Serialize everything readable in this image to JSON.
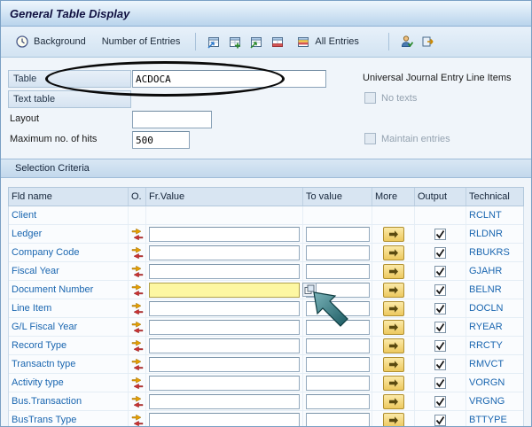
{
  "window": {
    "title": "General Table Display"
  },
  "toolbar": {
    "background": "Background",
    "number_of_entries": "Number of Entries",
    "all_entries": "All Entries"
  },
  "form": {
    "table_label": "Table",
    "table_value": "ACDOCA",
    "table_description": "Universal Journal Entry Line Items",
    "text_table_label": "Text table",
    "no_texts_label": "No texts",
    "layout_label": "Layout",
    "layout_value": "",
    "max_hits_label": "Maximum no. of hits",
    "max_hits_value": "500",
    "maintain_entries_label": "Maintain entries"
  },
  "selection": {
    "title": "Selection Criteria",
    "columns": [
      "Fld name",
      "O.",
      "Fr.Value",
      "To value",
      "More",
      "Output",
      "Technical"
    ],
    "rows": [
      {
        "name": "Client",
        "technical": "RCLNT",
        "option": false,
        "inputs": false,
        "more": false,
        "output": null,
        "highlight": false,
        "multi_icon": false
      },
      {
        "name": "Ledger",
        "technical": "RLDNR",
        "option": true,
        "inputs": true,
        "more": true,
        "output": true,
        "highlight": false,
        "multi_icon": false
      },
      {
        "name": "Company Code",
        "technical": "RBUKRS",
        "option": true,
        "inputs": true,
        "more": true,
        "output": true,
        "highlight": false,
        "multi_icon": false
      },
      {
        "name": "Fiscal Year",
        "technical": "GJAHR",
        "option": true,
        "inputs": true,
        "more": true,
        "output": true,
        "highlight": false,
        "multi_icon": false
      },
      {
        "name": "Document Number",
        "technical": "BELNR",
        "option": true,
        "inputs": true,
        "more": true,
        "output": true,
        "highlight": true,
        "multi_icon": true
      },
      {
        "name": "Line Item",
        "technical": "DOCLN",
        "option": true,
        "inputs": true,
        "more": true,
        "output": true,
        "highlight": false,
        "multi_icon": false
      },
      {
        "name": "G/L Fiscal Year",
        "technical": "RYEAR",
        "option": true,
        "inputs": true,
        "more": true,
        "output": true,
        "highlight": false,
        "multi_icon": false
      },
      {
        "name": "Record Type",
        "technical": "RRCTY",
        "option": true,
        "inputs": true,
        "more": true,
        "output": true,
        "highlight": false,
        "multi_icon": false
      },
      {
        "name": "Transactn type",
        "technical": "RMVCT",
        "option": true,
        "inputs": true,
        "more": true,
        "output": true,
        "highlight": false,
        "multi_icon": false
      },
      {
        "name": "Activity type",
        "technical": "VORGN",
        "option": true,
        "inputs": true,
        "more": true,
        "output": true,
        "highlight": false,
        "multi_icon": false
      },
      {
        "name": "Bus.Transaction",
        "technical": "VRGNG",
        "option": true,
        "inputs": true,
        "more": true,
        "output": true,
        "highlight": false,
        "multi_icon": false
      },
      {
        "name": "BusTrans Type",
        "technical": "BTTYPE",
        "option": true,
        "inputs": true,
        "more": true,
        "output": true,
        "highlight": false,
        "multi_icon": false
      }
    ]
  },
  "colors": {
    "accent_blue": "#1a66b0",
    "highlight_yellow": "#fdf7a2",
    "button_yellow": "#edc95f",
    "annotation_teal": "#1b5a61",
    "annotation_black": "#0a0a0a"
  }
}
